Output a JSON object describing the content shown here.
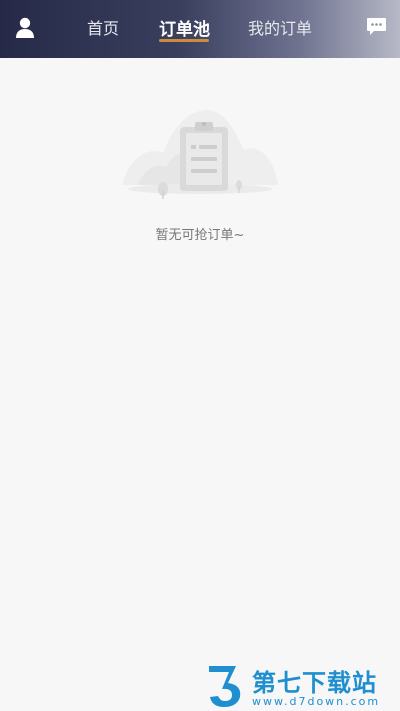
{
  "header": {
    "tabs": [
      {
        "label": "首页"
      },
      {
        "label": "订单池"
      },
      {
        "label": "我的订单"
      }
    ],
    "active_tab": "订单池",
    "accent_color": "#d0893d",
    "left_icon": "user-icon",
    "right_icon": "message-icon"
  },
  "empty_state": {
    "text": "暂无可抢订单~",
    "icon": "empty-clipboard-icon"
  },
  "watermark": {
    "brand": "第七下载站",
    "url": "www.d7down.com"
  }
}
